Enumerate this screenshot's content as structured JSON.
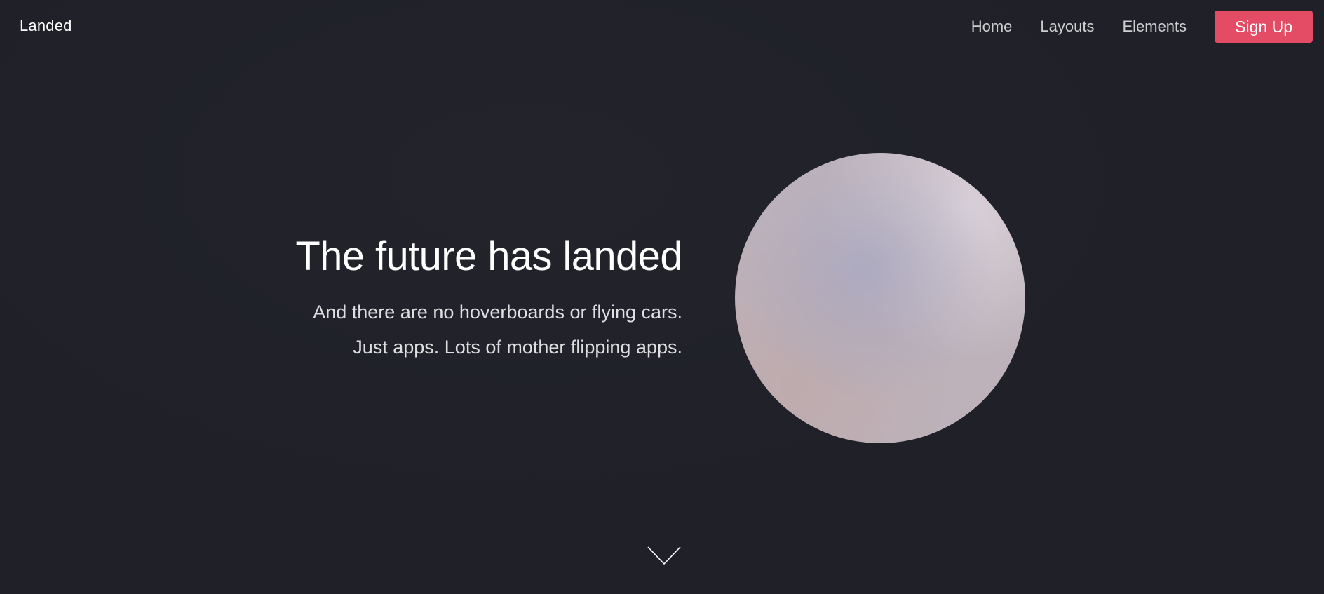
{
  "header": {
    "logo": "Landed",
    "nav": {
      "home": "Home",
      "layouts": "Layouts",
      "elements": "Elements",
      "signup": "Sign Up"
    }
  },
  "hero": {
    "title": "The future has landed",
    "line1": "And there are no hoverboards or flying cars.",
    "line2": "Just apps. Lots of mother flipping apps."
  },
  "icons": {
    "scroll_down": "chevron-down-icon"
  },
  "colors": {
    "background": "#1f2028",
    "accent": "#e44c65"
  }
}
